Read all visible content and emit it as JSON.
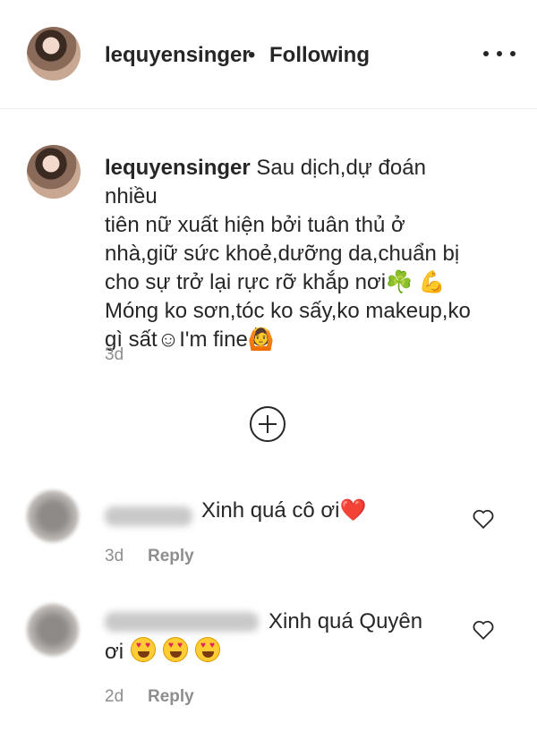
{
  "header": {
    "username": "lequyensinger",
    "separator": "•",
    "follow_status": "Following",
    "more_icon": "more-horizontal-icon"
  },
  "post": {
    "username": "lequyensinger",
    "caption_lines": [
      "Sau dịch,dự đoán nhiều",
      "tiên nữ xuất hiện bởi tuân thủ ở",
      "nhà,giữ sức khoẻ,dưỡng da,chuẩn bị",
      "cho sự trở lại rực rỡ khắp nơi☘️ 💪",
      "Móng ko sơn,tóc ko sấy,ko makeup,ko",
      "gì sất☺I'm fine🙆"
    ],
    "time": "3d"
  },
  "load_more_icon": "plus-circle-icon",
  "comments": [
    {
      "text": "Xinh quá cô ơi❤️",
      "time": "3d",
      "reply_label": "Reply"
    },
    {
      "text_line1": "Xinh quá Quyên",
      "text_line2": "ơi",
      "emojis": [
        "😍",
        "😍",
        "😍"
      ],
      "time": "2d",
      "reply_label": "Reply"
    }
  ],
  "colors": {
    "text": "#262626",
    "muted": "#8e8e8e",
    "divider": "#efefef"
  }
}
